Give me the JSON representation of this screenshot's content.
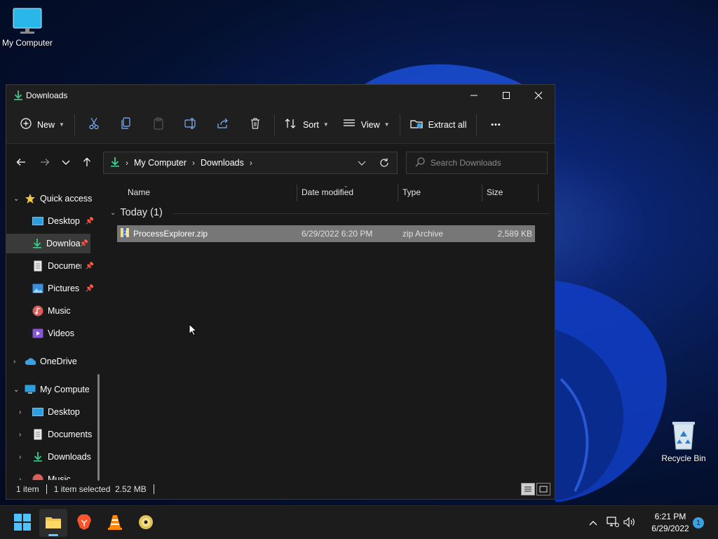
{
  "desktop": {
    "icons": [
      {
        "label": "My Computer"
      },
      {
        "label": "Recycle Bin"
      }
    ]
  },
  "window": {
    "title": "Downloads",
    "controls": {
      "minimize": "─",
      "maximize": "☐",
      "close": "✕"
    }
  },
  "commandbar": {
    "new_label": "New",
    "sort_label": "Sort",
    "view_label": "View",
    "extract_label": "Extract all",
    "more_label": "•••"
  },
  "address": {
    "crumbs": [
      "My Computer",
      "Downloads"
    ],
    "search_placeholder": "Search Downloads"
  },
  "navpane": {
    "items": [
      {
        "label": "Quick access"
      },
      {
        "label": "Desktop"
      },
      {
        "label": "Downloads"
      },
      {
        "label": "Documents"
      },
      {
        "label": "Pictures"
      },
      {
        "label": "Music"
      },
      {
        "label": "Videos"
      },
      {
        "label": "OneDrive"
      },
      {
        "label": "My Computer"
      },
      {
        "label": "Desktop"
      },
      {
        "label": "Documents"
      },
      {
        "label": "Downloads"
      },
      {
        "label": "Music"
      }
    ]
  },
  "filelist": {
    "columns": [
      "Name",
      "Date modified",
      "Type",
      "Size"
    ],
    "group_title": "Today (1)",
    "rows": [
      {
        "name": "ProcessExplorer.zip",
        "date": "6/29/2022 6:20 PM",
        "type": "zip Archive",
        "size": "2,589 KB"
      }
    ]
  },
  "statusbar": {
    "item_count": "1 item",
    "selection": "1 item selected  2.52 MB"
  },
  "taskbar": {
    "time": "6:21 PM",
    "date": "6/29/2022",
    "notification_count": "1"
  },
  "colors": {
    "accent": "#60cdff",
    "selection": "#777777",
    "window_bg": "#191919"
  }
}
